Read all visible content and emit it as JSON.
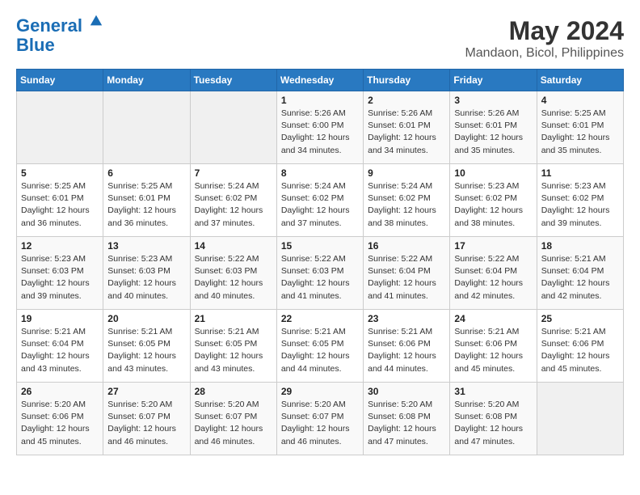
{
  "logo": {
    "line1": "General",
    "line2": "Blue"
  },
  "title": "May 2024",
  "subtitle": "Mandaon, Bicol, Philippines",
  "headers": [
    "Sunday",
    "Monday",
    "Tuesday",
    "Wednesday",
    "Thursday",
    "Friday",
    "Saturday"
  ],
  "weeks": [
    [
      {
        "day": "",
        "info": ""
      },
      {
        "day": "",
        "info": ""
      },
      {
        "day": "",
        "info": ""
      },
      {
        "day": "1",
        "info": "Sunrise: 5:26 AM\nSunset: 6:00 PM\nDaylight: 12 hours\nand 34 minutes."
      },
      {
        "day": "2",
        "info": "Sunrise: 5:26 AM\nSunset: 6:01 PM\nDaylight: 12 hours\nand 34 minutes."
      },
      {
        "day": "3",
        "info": "Sunrise: 5:26 AM\nSunset: 6:01 PM\nDaylight: 12 hours\nand 35 minutes."
      },
      {
        "day": "4",
        "info": "Sunrise: 5:25 AM\nSunset: 6:01 PM\nDaylight: 12 hours\nand 35 minutes."
      }
    ],
    [
      {
        "day": "5",
        "info": "Sunrise: 5:25 AM\nSunset: 6:01 PM\nDaylight: 12 hours\nand 36 minutes."
      },
      {
        "day": "6",
        "info": "Sunrise: 5:25 AM\nSunset: 6:01 PM\nDaylight: 12 hours\nand 36 minutes."
      },
      {
        "day": "7",
        "info": "Sunrise: 5:24 AM\nSunset: 6:02 PM\nDaylight: 12 hours\nand 37 minutes."
      },
      {
        "day": "8",
        "info": "Sunrise: 5:24 AM\nSunset: 6:02 PM\nDaylight: 12 hours\nand 37 minutes."
      },
      {
        "day": "9",
        "info": "Sunrise: 5:24 AM\nSunset: 6:02 PM\nDaylight: 12 hours\nand 38 minutes."
      },
      {
        "day": "10",
        "info": "Sunrise: 5:23 AM\nSunset: 6:02 PM\nDaylight: 12 hours\nand 38 minutes."
      },
      {
        "day": "11",
        "info": "Sunrise: 5:23 AM\nSunset: 6:02 PM\nDaylight: 12 hours\nand 39 minutes."
      }
    ],
    [
      {
        "day": "12",
        "info": "Sunrise: 5:23 AM\nSunset: 6:03 PM\nDaylight: 12 hours\nand 39 minutes."
      },
      {
        "day": "13",
        "info": "Sunrise: 5:23 AM\nSunset: 6:03 PM\nDaylight: 12 hours\nand 40 minutes."
      },
      {
        "day": "14",
        "info": "Sunrise: 5:22 AM\nSunset: 6:03 PM\nDaylight: 12 hours\nand 40 minutes."
      },
      {
        "day": "15",
        "info": "Sunrise: 5:22 AM\nSunset: 6:03 PM\nDaylight: 12 hours\nand 41 minutes."
      },
      {
        "day": "16",
        "info": "Sunrise: 5:22 AM\nSunset: 6:04 PM\nDaylight: 12 hours\nand 41 minutes."
      },
      {
        "day": "17",
        "info": "Sunrise: 5:22 AM\nSunset: 6:04 PM\nDaylight: 12 hours\nand 42 minutes."
      },
      {
        "day": "18",
        "info": "Sunrise: 5:21 AM\nSunset: 6:04 PM\nDaylight: 12 hours\nand 42 minutes."
      }
    ],
    [
      {
        "day": "19",
        "info": "Sunrise: 5:21 AM\nSunset: 6:04 PM\nDaylight: 12 hours\nand 43 minutes."
      },
      {
        "day": "20",
        "info": "Sunrise: 5:21 AM\nSunset: 6:05 PM\nDaylight: 12 hours\nand 43 minutes."
      },
      {
        "day": "21",
        "info": "Sunrise: 5:21 AM\nSunset: 6:05 PM\nDaylight: 12 hours\nand 43 minutes."
      },
      {
        "day": "22",
        "info": "Sunrise: 5:21 AM\nSunset: 6:05 PM\nDaylight: 12 hours\nand 44 minutes."
      },
      {
        "day": "23",
        "info": "Sunrise: 5:21 AM\nSunset: 6:06 PM\nDaylight: 12 hours\nand 44 minutes."
      },
      {
        "day": "24",
        "info": "Sunrise: 5:21 AM\nSunset: 6:06 PM\nDaylight: 12 hours\nand 45 minutes."
      },
      {
        "day": "25",
        "info": "Sunrise: 5:21 AM\nSunset: 6:06 PM\nDaylight: 12 hours\nand 45 minutes."
      }
    ],
    [
      {
        "day": "26",
        "info": "Sunrise: 5:20 AM\nSunset: 6:06 PM\nDaylight: 12 hours\nand 45 minutes."
      },
      {
        "day": "27",
        "info": "Sunrise: 5:20 AM\nSunset: 6:07 PM\nDaylight: 12 hours\nand 46 minutes."
      },
      {
        "day": "28",
        "info": "Sunrise: 5:20 AM\nSunset: 6:07 PM\nDaylight: 12 hours\nand 46 minutes."
      },
      {
        "day": "29",
        "info": "Sunrise: 5:20 AM\nSunset: 6:07 PM\nDaylight: 12 hours\nand 46 minutes."
      },
      {
        "day": "30",
        "info": "Sunrise: 5:20 AM\nSunset: 6:08 PM\nDaylight: 12 hours\nand 47 minutes."
      },
      {
        "day": "31",
        "info": "Sunrise: 5:20 AM\nSunset: 6:08 PM\nDaylight: 12 hours\nand 47 minutes."
      },
      {
        "day": "",
        "info": ""
      }
    ]
  ]
}
